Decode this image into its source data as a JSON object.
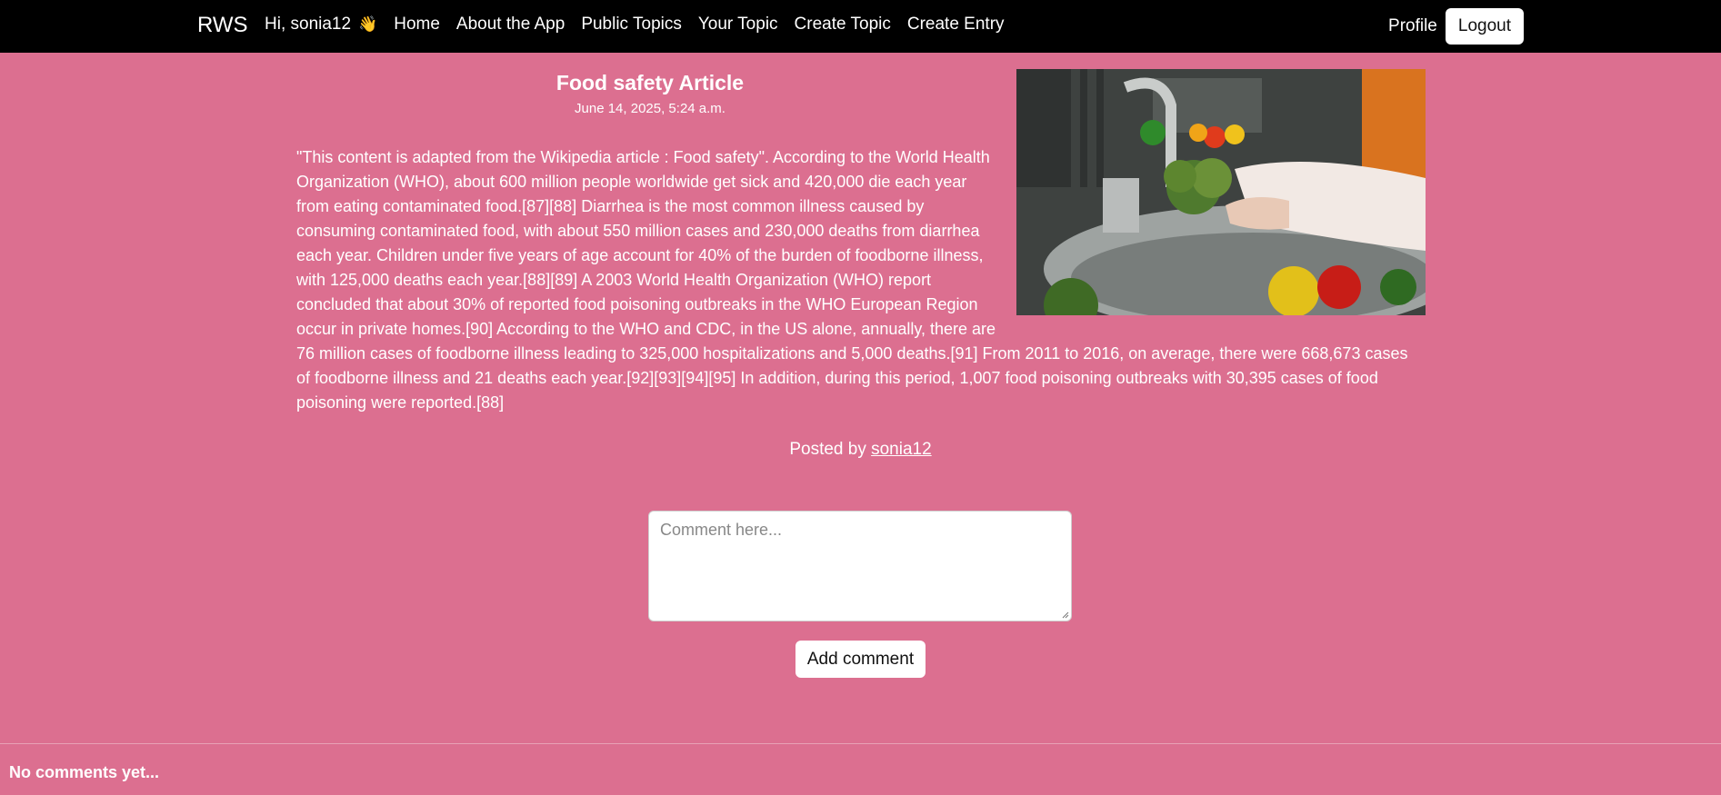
{
  "nav": {
    "brand": "RWS",
    "greeting": "Hi, sonia12",
    "greeting_icon": "waving-hand-icon",
    "links": [
      "Home",
      "About the App",
      "Public Topics",
      "Your Topic",
      "Create Topic",
      "Create Entry"
    ],
    "profile": "Profile",
    "logout": "Logout"
  },
  "article": {
    "title": "Food safety Article",
    "date": "June 14, 2025, 5:24 a.m.",
    "body": "\"This content is adapted from the Wikipedia article : Food safety\". According to the World Health Organization (WHO), about 600 million people worldwide get sick and 420,000 die each year from eating contaminated food.[87][88] Diarrhea is the most common illness caused by consuming contaminated food, with about 550 million cases and 230,000 deaths from diarrhea each year. Children under five years of age account for 40% of the burden of foodborne illness, with 125,000 deaths each year.[88][89] A 2003 World Health Organization (WHO) report concluded that about 30% of reported food poisoning outbreaks in the WHO European Region occur in private homes.[90] According to the WHO and CDC, in the US alone, annually, there are 76 million cases of foodborne illness leading to 325,000 hospitalizations and 5,000 deaths.[91] From 2011 to 2016, on average, there were 668,673 cases of foodborne illness and 21 deaths each year.[92][93][94][95] In addition, during this period, 1,007 food poisoning outbreaks with 30,395 cases of food poisoning were reported.[88]",
    "image_subject": "washing-vegetables-photo"
  },
  "posted": {
    "prefix": "Posted by",
    "user": "sonia12"
  },
  "comment": {
    "placeholder": "Comment here...",
    "button": "Add comment",
    "empty_message": "No comments yet..."
  },
  "colors": {
    "page_bg": "#dc6f90",
    "navbar_bg": "#000000"
  }
}
